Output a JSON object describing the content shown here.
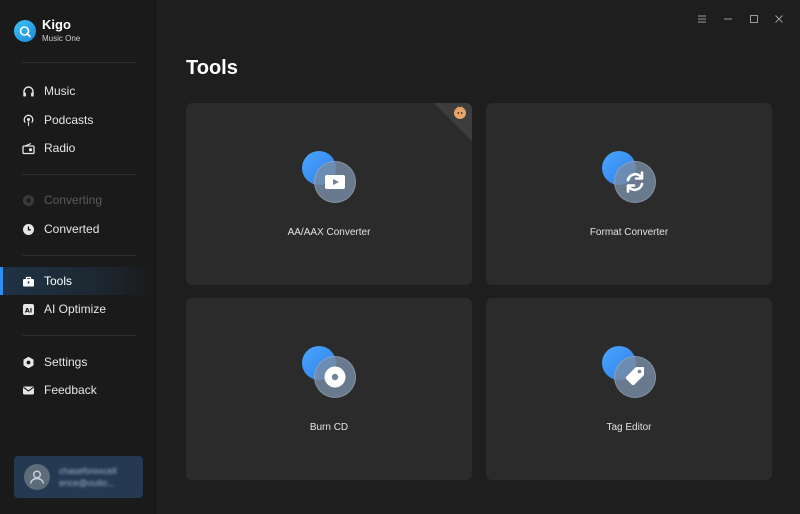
{
  "app": {
    "name": "Kigo",
    "subtitle": "Music One"
  },
  "sidebar": {
    "items": [
      {
        "label": "Music",
        "icon": "headphones-icon",
        "state": "normal"
      },
      {
        "label": "Podcasts",
        "icon": "podcast-icon",
        "state": "normal"
      },
      {
        "label": "Radio",
        "icon": "radio-icon",
        "state": "normal"
      },
      {
        "label": "Converting",
        "icon": "converting-icon",
        "state": "disabled"
      },
      {
        "label": "Converted",
        "icon": "clock-icon",
        "state": "normal"
      },
      {
        "label": "Tools",
        "icon": "toolbox-icon",
        "state": "active"
      },
      {
        "label": "AI Optimize",
        "icon": "ai-icon",
        "state": "normal"
      },
      {
        "label": "Settings",
        "icon": "settings-icon",
        "state": "normal"
      },
      {
        "label": "Feedback",
        "icon": "mail-icon",
        "state": "normal"
      }
    ]
  },
  "account": {
    "line1": "chaseforexcell",
    "line2": "ence@outlo..."
  },
  "window": {
    "controls": [
      "menu-icon",
      "minimize-icon",
      "maximize-icon",
      "close-icon"
    ]
  },
  "main": {
    "title": "Tools",
    "cards": [
      {
        "label": "AA/AAX Converter",
        "icon": "play-icon",
        "badge": "premium-fox-badge"
      },
      {
        "label": "Format Converter",
        "icon": "refresh-icon"
      },
      {
        "label": "Burn CD",
        "icon": "cd-icon"
      },
      {
        "label": "Tag Editor",
        "icon": "tag-icon"
      }
    ]
  },
  "colors": {
    "accent": "#2f8cf0",
    "sidebar_bg": "#1a1a1a",
    "main_bg": "#1e1e1e",
    "card_bg": "#2b2b2b",
    "account_bg": "#243a52"
  }
}
